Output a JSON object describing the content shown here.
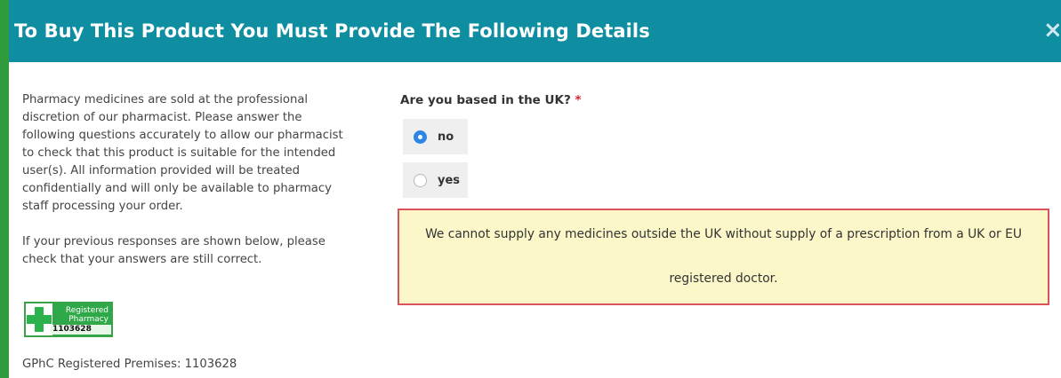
{
  "modal": {
    "title": "To Buy This Product You Must Provide The Following Details",
    "close_glyph": "×"
  },
  "info": {
    "paragraph1": "Pharmacy medicines are sold at the professional discretion of our pharmacist. Please answer the following questions accurately to allow our pharmacist to check that this product is suitable for the intended user(s). All information provided will be treated confidentially and will only be available to pharmacy staff processing your order.",
    "paragraph2": "If your previous responses are shown below, please check that your answers are still correct.",
    "badge_line1": "Registered",
    "badge_line2": "Pharmacy",
    "badge_number": "1103628",
    "gphc": "GPhC Registered Premises: 1103628"
  },
  "question": {
    "label": "Are you based in the UK?",
    "required_marker": "*",
    "options": [
      {
        "label": "no",
        "selected": true
      },
      {
        "label": "yes",
        "selected": false
      }
    ]
  },
  "alert": {
    "line1": "We cannot supply any medicines outside the UK without supply of a prescription from a UK or EU",
    "line2": "registered doctor."
  },
  "colors": {
    "header_bg": "#0e8ea0",
    "accent_green": "#2f9b3c",
    "radio_selected": "#2d86e4",
    "alert_bg": "#fcf7c8",
    "alert_border": "#d9535c",
    "required": "#d9232d"
  },
  "icons": {
    "close": "close-icon",
    "pharmacy_cross": "green-cross-icon"
  }
}
